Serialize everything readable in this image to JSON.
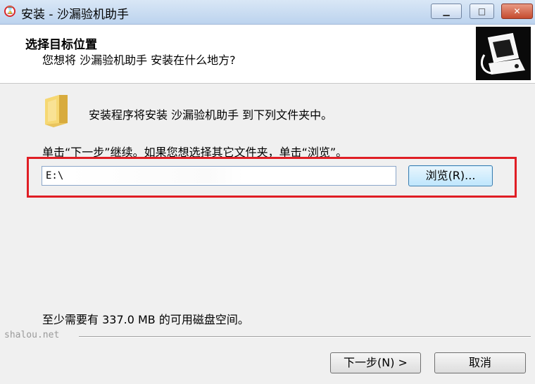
{
  "window": {
    "title": "安装 - 沙漏验机助手",
    "minimize_symbol": "▁",
    "maximize_symbol": "□",
    "close_symbol": "✕"
  },
  "header": {
    "title": "选择目标位置",
    "subtitle": "您想将 沙漏验机助手 安装在什么地方?"
  },
  "body": {
    "install_text": "安装程序将安装 沙漏验机助手 到下列文件夹中。",
    "instruction": "单击“下一步”继续。如果您想选择其它文件夹，单击“浏览”。",
    "path_value": "E:\\",
    "browse_label": "浏览(R)...",
    "space_text": "至少需要有 337.0 MB 的可用磁盘空间。"
  },
  "footer": {
    "brand": "shalou.net",
    "next_label": "下一步(N) >",
    "cancel_label": "取消"
  },
  "colors": {
    "highlight": "#e01e25"
  }
}
